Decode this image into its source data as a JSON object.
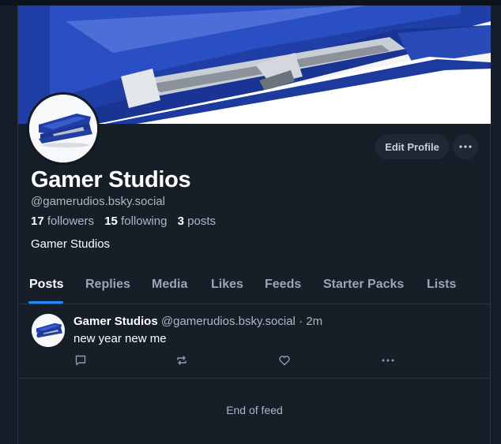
{
  "profile": {
    "display_name": "Gamer Studios",
    "handle": "@gamerudios.bsky.social",
    "followers_count": "17",
    "followers_label": "followers",
    "following_count": "15",
    "following_label": "following",
    "posts_count": "3",
    "posts_label": "posts",
    "bio": "Gamer Studios",
    "banner_icon": "stapler-image",
    "avatar_icon": "stapler-image"
  },
  "actions": {
    "edit_profile_label": "Edit Profile",
    "more_icon": "ellipsis-icon"
  },
  "tabs": [
    {
      "label": "Posts",
      "active": true
    },
    {
      "label": "Replies",
      "active": false
    },
    {
      "label": "Media",
      "active": false
    },
    {
      "label": "Likes",
      "active": false
    },
    {
      "label": "Feeds",
      "active": false
    },
    {
      "label": "Starter Packs",
      "active": false
    },
    {
      "label": "Lists",
      "active": false
    }
  ],
  "feed": {
    "posts": [
      {
        "author": "Gamer Studios",
        "handle": "@gamerudios.bsky.social",
        "separator": "·",
        "time": "2m",
        "text": "new year new me",
        "actions": [
          "reply-icon",
          "repost-icon",
          "like-icon",
          "more-icon"
        ]
      }
    ],
    "end_text": "End of feed"
  },
  "colors": {
    "background": "#161e27",
    "accent": "#208bfe",
    "stapler_blue": "#1e3fa8"
  }
}
